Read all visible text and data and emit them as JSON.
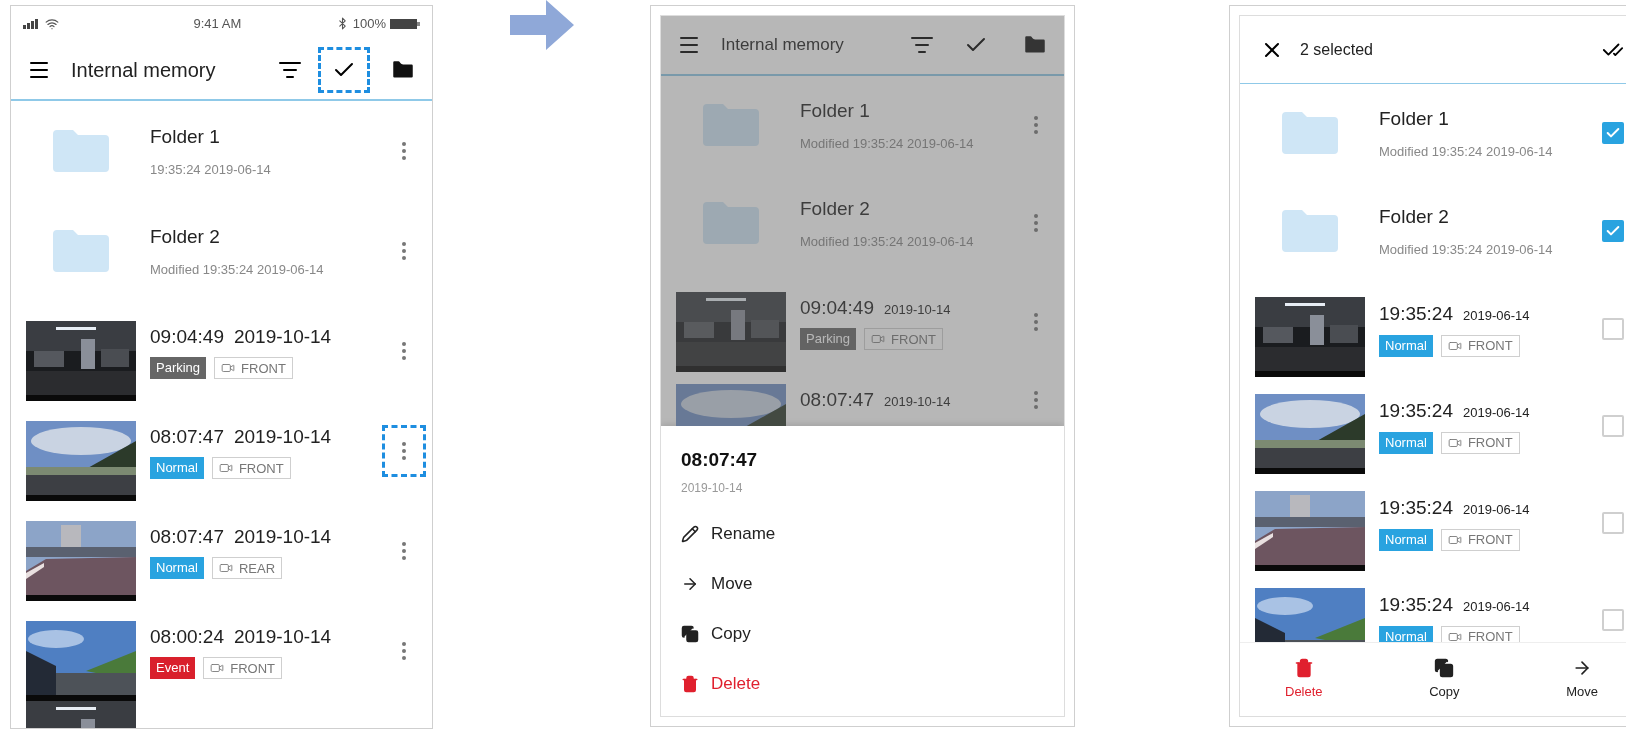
{
  "screens": [
    {
      "kind": "browse",
      "status_bar": {
        "time": "9:41 AM",
        "battery": "100%"
      },
      "header": {
        "title": "Internal memory",
        "select_highlighted": true
      },
      "items": [
        {
          "kind": "folder",
          "name": "Folder 1",
          "detail": "19:35:24 2019-06-14",
          "highlighted": false
        },
        {
          "kind": "folder",
          "name": "Folder 2",
          "detail": "Modified 19:35:24 2019-06-14",
          "highlighted": false
        },
        {
          "kind": "video",
          "time": "09:04:49",
          "date": "2019-10-14",
          "tag": "Parking",
          "color": "#666666",
          "camera": "FRONT",
          "highlighted": false
        },
        {
          "kind": "video",
          "time": "08:07:47",
          "date": "2019-10-14",
          "tag": "Normal",
          "color": "#29a3e0",
          "camera": "FRONT",
          "highlighted": true
        },
        {
          "kind": "video",
          "time": "08:07:47",
          "date": "2019-10-14",
          "tag": "Normal",
          "color": "#29a3e0",
          "camera": "REAR",
          "highlighted": false
        },
        {
          "kind": "video",
          "time": "08:00:24",
          "date": "2019-10-14",
          "tag": "Event",
          "color": "#d9202c",
          "camera": "FRONT",
          "highlighted": false
        },
        {
          "kind": "picture"
        }
      ]
    },
    {
      "kind": "menu",
      "header": {
        "title": "Internal memory",
        "select_highlighted": false
      },
      "items": [
        {
          "kind": "folder",
          "name": "Folder 1",
          "detail": "Modified 19:35:24 2019-06-14",
          "highlighted": false
        },
        {
          "kind": "folder",
          "name": "Folder 2",
          "detail": "Modified 19:35:24 2019-06-14",
          "highlighted": false
        },
        {
          "kind": "video",
          "time": "09:04:49",
          "date": "2019-10-14",
          "tag": "Parking",
          "color": "#666666",
          "camera": "FRONT",
          "highlighted": false
        },
        {
          "kind": "video",
          "time": "08:07:47",
          "date": "2019-10-14",
          "highlighted": false
        }
      ],
      "sheet": {
        "title": "08:07:47",
        "subtitle": "2019-10-14",
        "actions": [
          {
            "kind": "rename",
            "label": "Rename"
          },
          {
            "kind": "move",
            "label": "Move"
          },
          {
            "kind": "copy",
            "label": "Copy"
          },
          {
            "kind": "delete",
            "label": "Delete"
          }
        ]
      }
    },
    {
      "kind": "select",
      "header": {
        "title": "2 selected"
      },
      "items": [
        {
          "kind": "folder",
          "name": "Folder 1",
          "detail": "Modified 19:35:24 2019-06-14",
          "checked": true
        },
        {
          "kind": "folder",
          "name": "Folder 2",
          "detail": "Modified 19:35:24 2019-06-14",
          "checked": true
        },
        {
          "kind": "video",
          "time": "19:35:24",
          "date": "2019-06-14",
          "tag": "Normal",
          "color": "#29a3e0",
          "camera": "FRONT",
          "checked": false
        },
        {
          "kind": "video",
          "time": "19:35:24",
          "date": "2019-06-14",
          "tag": "Normal",
          "color": "#29a3e0",
          "camera": "FRONT",
          "checked": false
        },
        {
          "kind": "video",
          "time": "19:35:24",
          "date": "2019-06-14",
          "tag": "Normal",
          "color": "#29a3e0",
          "camera": "FRONT",
          "checked": false
        },
        {
          "kind": "video",
          "time": "19:35:24",
          "date": "2019-06-14",
          "tag": "Normal",
          "color": "#29a3e0",
          "camera": "FRONT",
          "checked": false
        }
      ],
      "bottom_bar": [
        {
          "kind": "delete",
          "label": "Delete"
        },
        {
          "kind": "copy",
          "label": "Copy"
        },
        {
          "kind": "move",
          "label": "Move"
        }
      ]
    }
  ]
}
